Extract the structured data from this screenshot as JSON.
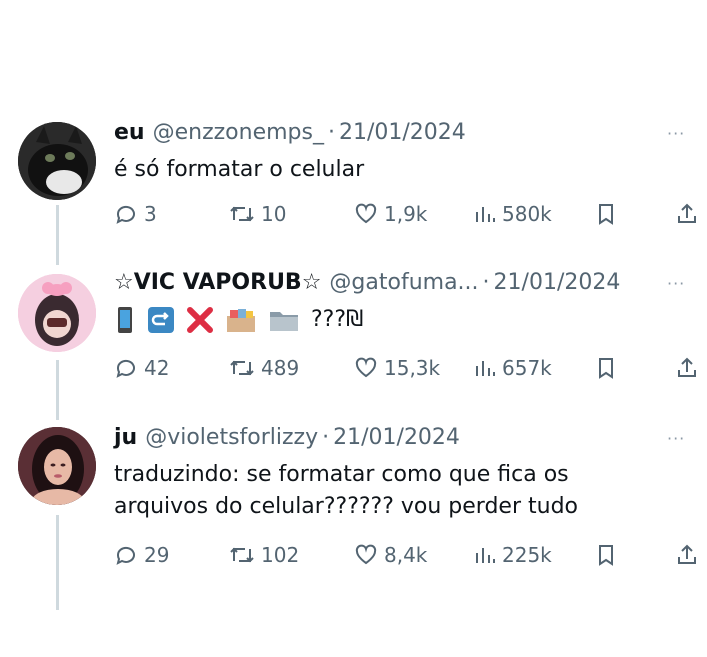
{
  "tweets": [
    {
      "name": "eu",
      "handle": "@enzzonemps_",
      "dot": "·",
      "date": "21/01/2024",
      "more": "···",
      "text": "é só formatar o celular",
      "replies": "3",
      "retweets": "10",
      "likes": "1,9k",
      "views": "580k",
      "avatar_icon": "cat-avatar"
    },
    {
      "name": "☆VIC VAPORUB☆",
      "handle": "@gatofuma...",
      "dot": "·",
      "date": "21/01/2024",
      "more": "···",
      "text_emoji": [
        "mobile-phone-icon",
        "rotate-arrow-icon",
        "cross-mark-icon",
        "card-file-box-icon",
        "file-folder-icon"
      ],
      "text_suffix": "???₪",
      "replies": "42",
      "retweets": "489",
      "likes": "15,3k",
      "views": "657k",
      "avatar_icon": "doll-avatar"
    },
    {
      "name": "ju",
      "handle": "@violetsforlizzy",
      "dot": "·",
      "date": "21/01/2024",
      "more": "···",
      "text_line1": "traduzindo: se formatar como que fica os",
      "text_line2": "arquivos do celular?????? vou perder tudo",
      "replies": "29",
      "retweets": "102",
      "likes": "8,4k",
      "views": "225k",
      "avatar_icon": "woman-avatar"
    }
  ],
  "colors": {
    "text": "#0f1419",
    "muted": "#536471",
    "line": "#cfd9de"
  }
}
